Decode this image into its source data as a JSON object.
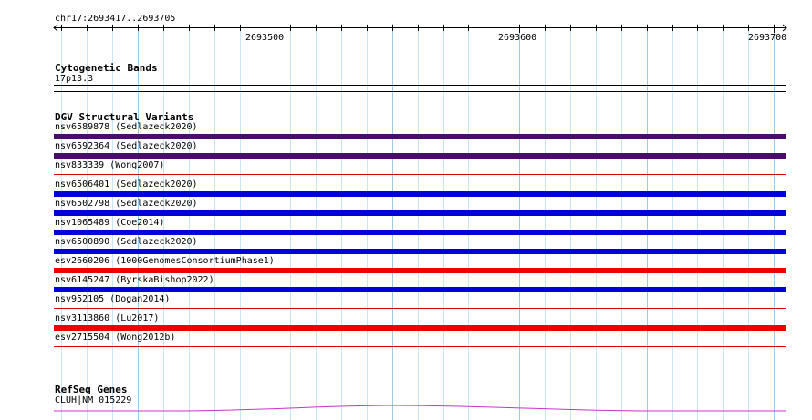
{
  "ruler": {
    "position_label": "chr17:2693417..2693705",
    "ticks": [
      {
        "label": "2693500",
        "pos": 2693500
      },
      {
        "label": "2693600",
        "pos": 2693600
      },
      {
        "label": "2693700",
        "pos": 2693700
      }
    ]
  },
  "cytoband": {
    "title": "Cytogenetic Bands",
    "band_label": "17p13.3"
  },
  "dgv": {
    "title": "DGV Structural Variants",
    "variants": [
      {
        "label": "nsv6589878 (Sedlazeck2020)",
        "color": "#4b0d6b",
        "style": "thick"
      },
      {
        "label": "nsv6592364 (Sedlazeck2020)",
        "color": "#4b0d6b",
        "style": "thick"
      },
      {
        "label": "nsv833339 (Wong2007)",
        "color": "#dd0000",
        "style": "thin"
      },
      {
        "label": "nsv6506401 (Sedlazeck2020)",
        "color": "#0000dd",
        "style": "thick"
      },
      {
        "label": "nsv6502798 (Sedlazeck2020)",
        "color": "#0000dd",
        "style": "thick"
      },
      {
        "label": "nsv1065489 (Coe2014)",
        "color": "#0000dd",
        "style": "thick"
      },
      {
        "label": "nsv6500890 (Sedlazeck2020)",
        "color": "#0000dd",
        "style": "thick"
      },
      {
        "label": "esv2660206 (1000GenomesConsortiumPhase1)",
        "color": "#ee0000",
        "style": "thick"
      },
      {
        "label": "nsv6145247 (ByrskaBishop2022)",
        "color": "#0000dd",
        "style": "thick"
      },
      {
        "label": "nsv952105 (Dogan2014)",
        "color": "#dd0000",
        "style": "thin"
      },
      {
        "label": "nsv3113860 (Lu2017)",
        "color": "#ee0000",
        "style": "thick"
      },
      {
        "label": "esv2715504 (Wong2012b)",
        "color": "#dd0000",
        "style": "thin"
      }
    ]
  },
  "refseq": {
    "title": "RefSeq Genes",
    "gene_label": "CLUH|NM_015229",
    "color": "#cc33cc"
  },
  "colors": {
    "grid_light": "#c8e6f6",
    "grid_dark": "#9fcbe8"
  }
}
